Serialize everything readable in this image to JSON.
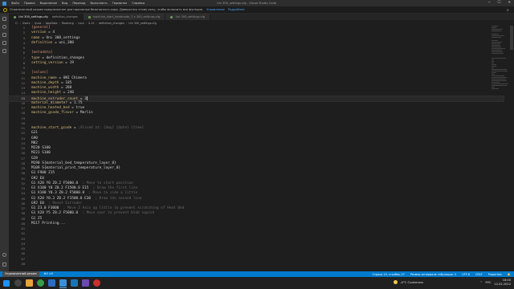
{
  "window": {
    "title": "Uni 300_settings.cfg - Visual Studio Code",
    "menu": [
      "Файл",
      "Правка",
      "Выделение",
      "Вид",
      "Переход",
      "Выполнить",
      "Терминал",
      "Справка"
    ],
    "controls": {
      "minimize": "─",
      "maximize": "☐",
      "close": "✕"
    }
  },
  "notice": {
    "text": "Ограниченный режим предназначен для просмотра безопасного кода. Доверьтесь этому окну, чтобы включить все функции.",
    "manage": "Управление",
    "learn_more": "Подробнее",
    "close": "✕"
  },
  "tabs": [
    {
      "label": "Uni 300_settings.cfg",
      "suffix": "definition_changes",
      "active": true
    },
    {
      "label": "machine_start_heatmade_1 x 300_settings.cfg",
      "suffix": "",
      "active": false
    },
    {
      "label": "Uni 300_settings.cfg",
      "suffix": "",
      "active": false
    }
  ],
  "breadcrumbs": [
    "C:",
    "Users",
    "lyuss",
    "AppData",
    "Roaming",
    "cura",
    "4.12",
    "definition_changes",
    "Uni 300_settings.cfg"
  ],
  "editor": {
    "lines": [
      {
        "n": "1",
        "text": "[general]",
        "type": "section"
      },
      {
        "n": "2",
        "key": "version",
        "val": "4",
        "type": "kv"
      },
      {
        "n": "3",
        "key": "name",
        "val": "Uni 300_settings",
        "type": "kv"
      },
      {
        "n": "4",
        "key": "definition",
        "val": "uni_300",
        "type": "kv"
      },
      {
        "n": "5",
        "text": "",
        "type": "blank"
      },
      {
        "n": "6",
        "text": "[metadata]",
        "type": "section"
      },
      {
        "n": "7",
        "key": "type",
        "val": "definition_changes",
        "type": "kv"
      },
      {
        "n": "8",
        "key": "setting_version",
        "val": "19",
        "type": "kv"
      },
      {
        "n": "9",
        "text": "",
        "type": "blank"
      },
      {
        "n": "10",
        "text": "[values]",
        "type": "section"
      },
      {
        "n": "11",
        "key": "machine_name",
        "val": "UNI Chimera",
        "type": "kv"
      },
      {
        "n": "12",
        "key": "machine_depth",
        "val": "185",
        "type": "kv"
      },
      {
        "n": "13",
        "key": "machine_width",
        "val": "288",
        "type": "kv"
      },
      {
        "n": "14",
        "key": "machine_height",
        "val": "240",
        "type": "kv"
      },
      {
        "n": "15",
        "key": "machine_extruder_count",
        "val": "3",
        "type": "kv",
        "current": true
      },
      {
        "n": "16",
        "key": "material_diameter",
        "val": "1.75",
        "type": "kv"
      },
      {
        "n": "17",
        "key": "machine_heated_bed",
        "val": "true",
        "type": "kv"
      },
      {
        "n": "18",
        "key": "machine_gcode_flavor",
        "val": "Marlin",
        "type": "kv"
      },
      {
        "n": "19",
        "text": "",
        "type": "blank"
      },
      {
        "n": "20",
        "text": "",
        "type": "blank"
      },
      {
        "n": "21",
        "key": "machine_start_gcode",
        "val": "",
        "comment": ";Sliced at: {day} {date} {time}",
        "type": "kv"
      },
      {
        "n": "22",
        "text": "G21",
        "type": "cmd"
      },
      {
        "n": "23",
        "text": "G90",
        "type": "cmd"
      },
      {
        "n": "24",
        "text": "M82",
        "type": "cmd"
      },
      {
        "n": "25",
        "text": "M220 S100",
        "type": "cmd"
      },
      {
        "n": "26",
        "text": "M221 S100",
        "type": "cmd"
      },
      {
        "n": "27",
        "text": "G28",
        "type": "cmd"
      },
      {
        "n": "28",
        "text": "M190 S{material_bed_temperature_layer_0}",
        "type": "cmd"
      },
      {
        "n": "29",
        "text": "M109 S{material_print_temperature_layer_0}",
        "type": "cmd"
      },
      {
        "n": "30",
        "text": "G1 F900 Z15",
        "type": "cmd"
      },
      {
        "n": "31",
        "text": "G92 E0",
        "type": "cmd"
      },
      {
        "n": "32",
        "text": "G1 X20 Y0 Z0.2 F5000.0",
        "comment": "; Move to start position",
        "type": "cmd"
      },
      {
        "n": "33",
        "text": "G1 X100 Y0 Z0.2 F1500.0 E15",
        "comment": "; Draw the first line",
        "type": "cmd"
      },
      {
        "n": "34",
        "text": "G1 X100 Y0.3 Z0.2 F5000.0",
        "comment": "; Move to side a little",
        "type": "cmd"
      },
      {
        "n": "35",
        "text": "G1 X20 Y0.3 Z0.2 F1500.0 E30",
        "comment": "; Draw the second line",
        "type": "cmd"
      },
      {
        "n": "36",
        "text": "G92 E0",
        "comment": "; Reset Extruder",
        "type": "cmd"
      },
      {
        "n": "37",
        "text": "G1 Z3.0 F3000",
        "comment": "; Move Z Axis up little to prevent scratching of Heat Bed",
        "type": "cmd"
      },
      {
        "n": "38",
        "text": "G1 X20 Y5 Z0.2 F5000.0",
        "comment": "; Move over to prevent blob squish",
        "type": "cmd"
      },
      {
        "n": "39",
        "text": "G1 Z5",
        "type": "cmd"
      },
      {
        "n": "40",
        "text": "M117 Printing...",
        "type": "cmd"
      },
      {
        "n": "41",
        "text": "",
        "type": "blank"
      },
      {
        "n": "42",
        "text": "",
        "type": "blank"
      },
      {
        "n": "43",
        "text": "",
        "type": "blank"
      },
      {
        "n": "44",
        "text": "",
        "type": "blank"
      },
      {
        "n": "45",
        "text": "",
        "type": "blank"
      },
      {
        "n": "46",
        "text": "",
        "type": "blank"
      },
      {
        "n": "47",
        "text": "",
        "type": "blank"
      },
      {
        "n": "48",
        "text": "",
        "type": "blank"
      }
    ]
  },
  "status": {
    "restricted": "Ограниченный режим",
    "errors": "⊗0 ⚠0",
    "position": "Строка 15, столбец 27",
    "indent": "Размер интервала табуляции: 2",
    "encoding": "UTF-8",
    "eol": "CRLF",
    "language": "Properties"
  },
  "taskbar": {
    "weather": "-4°C  Солнечно",
    "lang": "РУС",
    "time": "18:00",
    "date": "12.02.2022"
  },
  "colors": {
    "accent": "#007acc",
    "key": "#d7ba7d",
    "section": "#ce9178",
    "comment": "#6a6a6a"
  }
}
